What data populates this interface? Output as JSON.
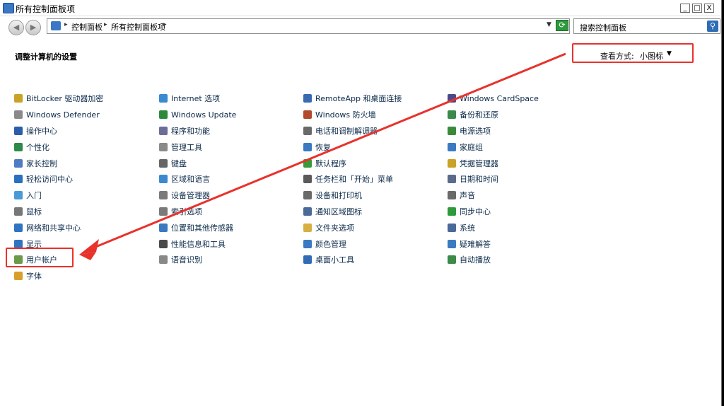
{
  "window": {
    "title": "所有控制面板项",
    "controls": {
      "minimize": "_",
      "maximize": "□",
      "close": "X"
    }
  },
  "nav": {
    "back_icon": "back-arrow-icon",
    "forward_icon": "forward-arrow-icon",
    "breadcrumb": [
      "控制面板",
      "所有控制面板项"
    ],
    "search_placeholder": "搜索控制面板"
  },
  "page": {
    "heading": "调整计算机的设置",
    "view_by_label": "查看方式:",
    "view_by_value": "小图标"
  },
  "columns": [
    [
      {
        "label": "BitLocker 驱动器加密",
        "icon": "bitlocker-icon",
        "color": "#c9a227"
      },
      {
        "label": "Windows Defender",
        "icon": "defender-icon",
        "color": "#8a8a8a"
      },
      {
        "label": "操作中心",
        "icon": "flag-icon",
        "color": "#2a5ea8"
      },
      {
        "label": "个性化",
        "icon": "personalize-icon",
        "color": "#2c8a4a"
      },
      {
        "label": "家长控制",
        "icon": "parental-icon",
        "color": "#4f7bc2"
      },
      {
        "label": "轻松访问中心",
        "icon": "ease-access-icon",
        "color": "#2b6fbf"
      },
      {
        "label": "入门",
        "icon": "getting-started-icon",
        "color": "#4a9ad8"
      },
      {
        "label": "鼠标",
        "icon": "mouse-icon",
        "color": "#777777"
      },
      {
        "label": "网络和共享中心",
        "icon": "network-icon",
        "color": "#2f74c0"
      },
      {
        "label": "显示",
        "icon": "display-icon",
        "color": "#2f74c0"
      },
      {
        "label": "用户帐户",
        "icon": "user-accounts-icon",
        "color": "#6a9a4a"
      },
      {
        "label": "字体",
        "icon": "fonts-icon",
        "color": "#d8a02b"
      }
    ],
    [
      {
        "label": "Internet 选项",
        "icon": "internet-icon",
        "color": "#3a8ad0"
      },
      {
        "label": "Windows Update",
        "icon": "update-icon",
        "color": "#2e8a3b"
      },
      {
        "label": "程序和功能",
        "icon": "programs-icon",
        "color": "#6d6d9a"
      },
      {
        "label": "管理工具",
        "icon": "admin-tools-icon",
        "color": "#8a8a8a"
      },
      {
        "label": "键盘",
        "icon": "keyboard-icon",
        "color": "#666666"
      },
      {
        "label": "区域和语言",
        "icon": "region-icon",
        "color": "#3b8ad0"
      },
      {
        "label": "设备管理器",
        "icon": "device-manager-icon",
        "color": "#7a7a7a"
      },
      {
        "label": "索引选项",
        "icon": "indexing-icon",
        "color": "#7a7a7a"
      },
      {
        "label": "位置和其他传感器",
        "icon": "location-icon",
        "color": "#3a7ac0"
      },
      {
        "label": "性能信息和工具",
        "icon": "performance-icon",
        "color": "#4a4a4a"
      },
      {
        "label": "语音识别",
        "icon": "microphone-icon",
        "color": "#888888"
      }
    ],
    [
      {
        "label": "RemoteApp 和桌面连接",
        "icon": "remoteapp-icon",
        "color": "#3a6ab0"
      },
      {
        "label": "Windows 防火墙",
        "icon": "firewall-icon",
        "color": "#b04a2a"
      },
      {
        "label": "电话和调制解调器",
        "icon": "phone-icon",
        "color": "#6a6a6a"
      },
      {
        "label": "恢复",
        "icon": "recovery-icon",
        "color": "#3a7ac0"
      },
      {
        "label": "默认程序",
        "icon": "default-programs-icon",
        "color": "#3a9a3a"
      },
      {
        "label": "任务栏和「开始」菜单",
        "icon": "taskbar-icon",
        "color": "#5a5a5a"
      },
      {
        "label": "设备和打印机",
        "icon": "printer-icon",
        "color": "#6a6a6a"
      },
      {
        "label": "通知区域图标",
        "icon": "notification-icon",
        "color": "#4a6a9a"
      },
      {
        "label": "文件夹选项",
        "icon": "folder-options-icon",
        "color": "#d8b040"
      },
      {
        "label": "颜色管理",
        "icon": "color-management-icon",
        "color": "#3a7ac0"
      },
      {
        "label": "桌面小工具",
        "icon": "gadgets-icon",
        "color": "#2f6cb5"
      }
    ],
    [
      {
        "label": "Windows CardSpace",
        "icon": "cardspace-icon",
        "color": "#4a4a8a"
      },
      {
        "label": "备份和还原",
        "icon": "backup-icon",
        "color": "#3a8a4a"
      },
      {
        "label": "电源选项",
        "icon": "power-icon",
        "color": "#3a8a3a"
      },
      {
        "label": "家庭组",
        "icon": "homegroup-icon",
        "color": "#3a7ac0"
      },
      {
        "label": "凭据管理器",
        "icon": "credential-icon",
        "color": "#c9a227"
      },
      {
        "label": "日期和时间",
        "icon": "clock-icon",
        "color": "#5a6a8a"
      },
      {
        "label": "声音",
        "icon": "speaker-icon",
        "color": "#6a6a6a"
      },
      {
        "label": "同步中心",
        "icon": "sync-icon",
        "color": "#2e9a3b"
      },
      {
        "label": "系统",
        "icon": "system-icon",
        "color": "#4a6a9a"
      },
      {
        "label": "疑难解答",
        "icon": "troubleshoot-icon",
        "color": "#3a7ac0"
      },
      {
        "label": "自动播放",
        "icon": "autoplay-icon",
        "color": "#3a8a4a"
      }
    ]
  ],
  "annotation_color": "#e8322c"
}
